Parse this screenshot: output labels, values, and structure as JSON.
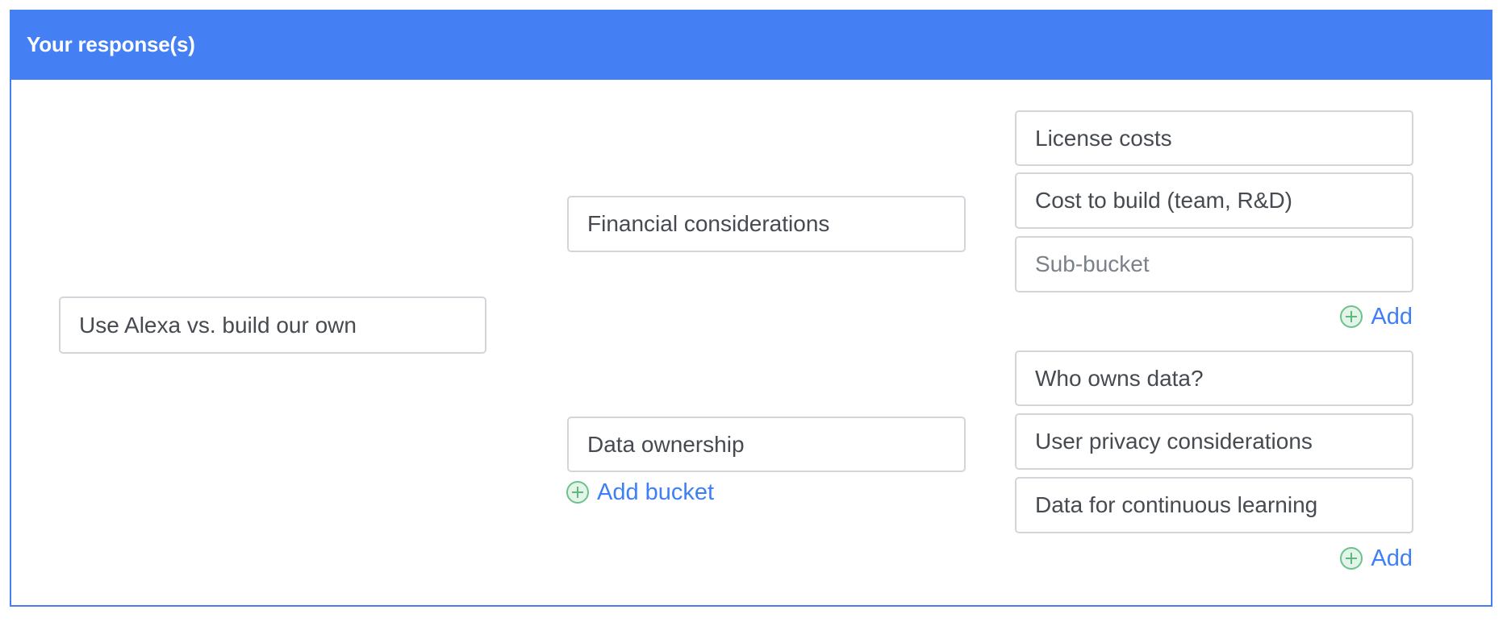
{
  "panel": {
    "title": "Your response(s)",
    "accent_color": "#4480f3"
  },
  "root": {
    "value": "Use Alexa vs. build our own"
  },
  "buckets": [
    {
      "value": "Financial considerations",
      "sub_buckets": [
        {
          "value": "License costs",
          "placeholder": ""
        },
        {
          "value": "Cost to build (team, R&D)",
          "placeholder": ""
        },
        {
          "value": "",
          "placeholder": "Sub-bucket"
        }
      ],
      "add_label": "Add"
    },
    {
      "value": "Data ownership",
      "sub_buckets": [
        {
          "value": "Who owns data?",
          "placeholder": ""
        },
        {
          "value": "User privacy considerations",
          "placeholder": ""
        },
        {
          "value": "Data for continuous learning",
          "placeholder": ""
        }
      ],
      "add_label": "Add"
    }
  ],
  "add_bucket_label": "Add bucket",
  "icons": {
    "add": "plus-circle-icon"
  }
}
